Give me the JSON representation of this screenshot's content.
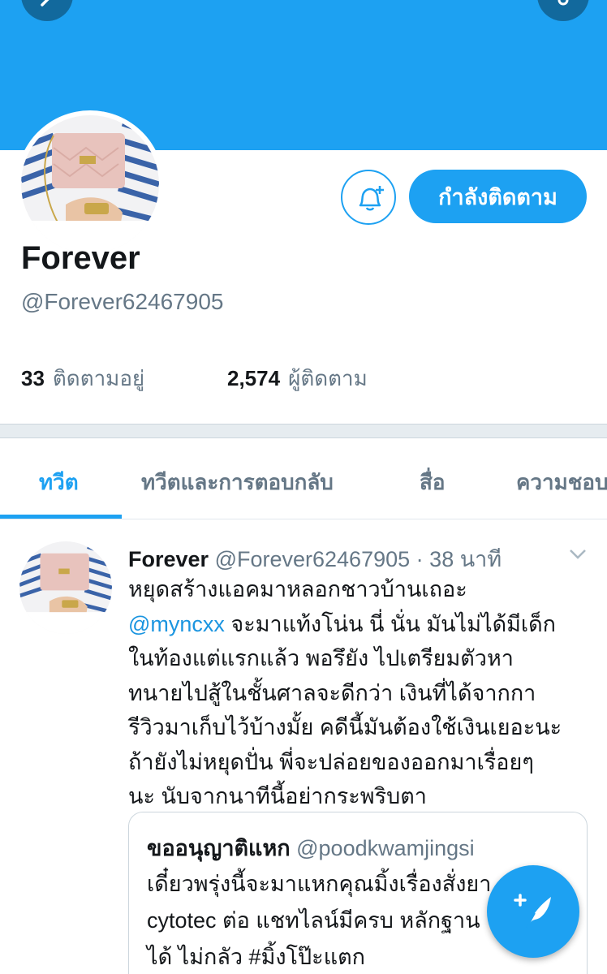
{
  "profile": {
    "display_name": "Forever",
    "handle": "@Forever62467905",
    "follow_button_label": "กำลังติดตาม",
    "following_count": "33",
    "following_label": "ติดตามอยู่",
    "followers_count": "2,574",
    "followers_label": "ผู้ติดตาม"
  },
  "tabs": [
    {
      "label": "ทวีต",
      "active": true
    },
    {
      "label": "ทวีตและการตอบกลับ",
      "active": false
    },
    {
      "label": "สื่อ",
      "active": false
    },
    {
      "label": "ความชอบ",
      "active": false
    }
  ],
  "tweet": {
    "name": "Forever",
    "handle": "@Forever62467905",
    "separator": "·",
    "time": "38 นาที",
    "lines": {
      "l1": "หยุดสร้างแอคมาหลอกชาวบ้านเถอะ",
      "l2_mention": "@myncxx",
      "l2_rest": " จะมาแท้งโน่น นี่ นั่น มันไม่ได้มีเด็ก",
      "l3": "ในท้องแต่แรกแล้ว พอรึยัง ไปเตรียมตัวหา",
      "l4": "ทนายไปสู้ในชั้นศาลจะดีกว่า เงินที่ได้จากกา",
      "l5": "รีวิวมาเก็บไว้บ้างมั้ย คดีนี้มันต้องใช้เงินเยอะนะ",
      "l6": "ถ้ายังไม่หยุดปั่น พี่จะปล่อยของออกมาเรื่อยๆ",
      "l7": "นะ นับจากนาทีนี้อย่ากระพริบตา"
    }
  },
  "quote": {
    "name": "ขออนุญาติแหก",
    "handle": "@poodkwamjingsi",
    "lines": {
      "l1": "เดี๋ยวพรุ่งนี้จะมาแหกคุณมิ้งเรื่องสั่งยา",
      "l2": "cytotec ต่อ แชทไลน์มีครบ หลักฐาน",
      "l3": "ได้ ไม่กลัว #มิ้งโป๊ะแตก"
    }
  },
  "icons": {
    "back": "back-arrow-icon",
    "more": "more-options-icon",
    "bell": "bell-plus-icon",
    "caret": "chevron-down-icon",
    "compose": "compose-feather-icon"
  },
  "colors": {
    "accent": "#1da1f2",
    "secondary_text": "#657786",
    "primary_text": "#14171a"
  }
}
